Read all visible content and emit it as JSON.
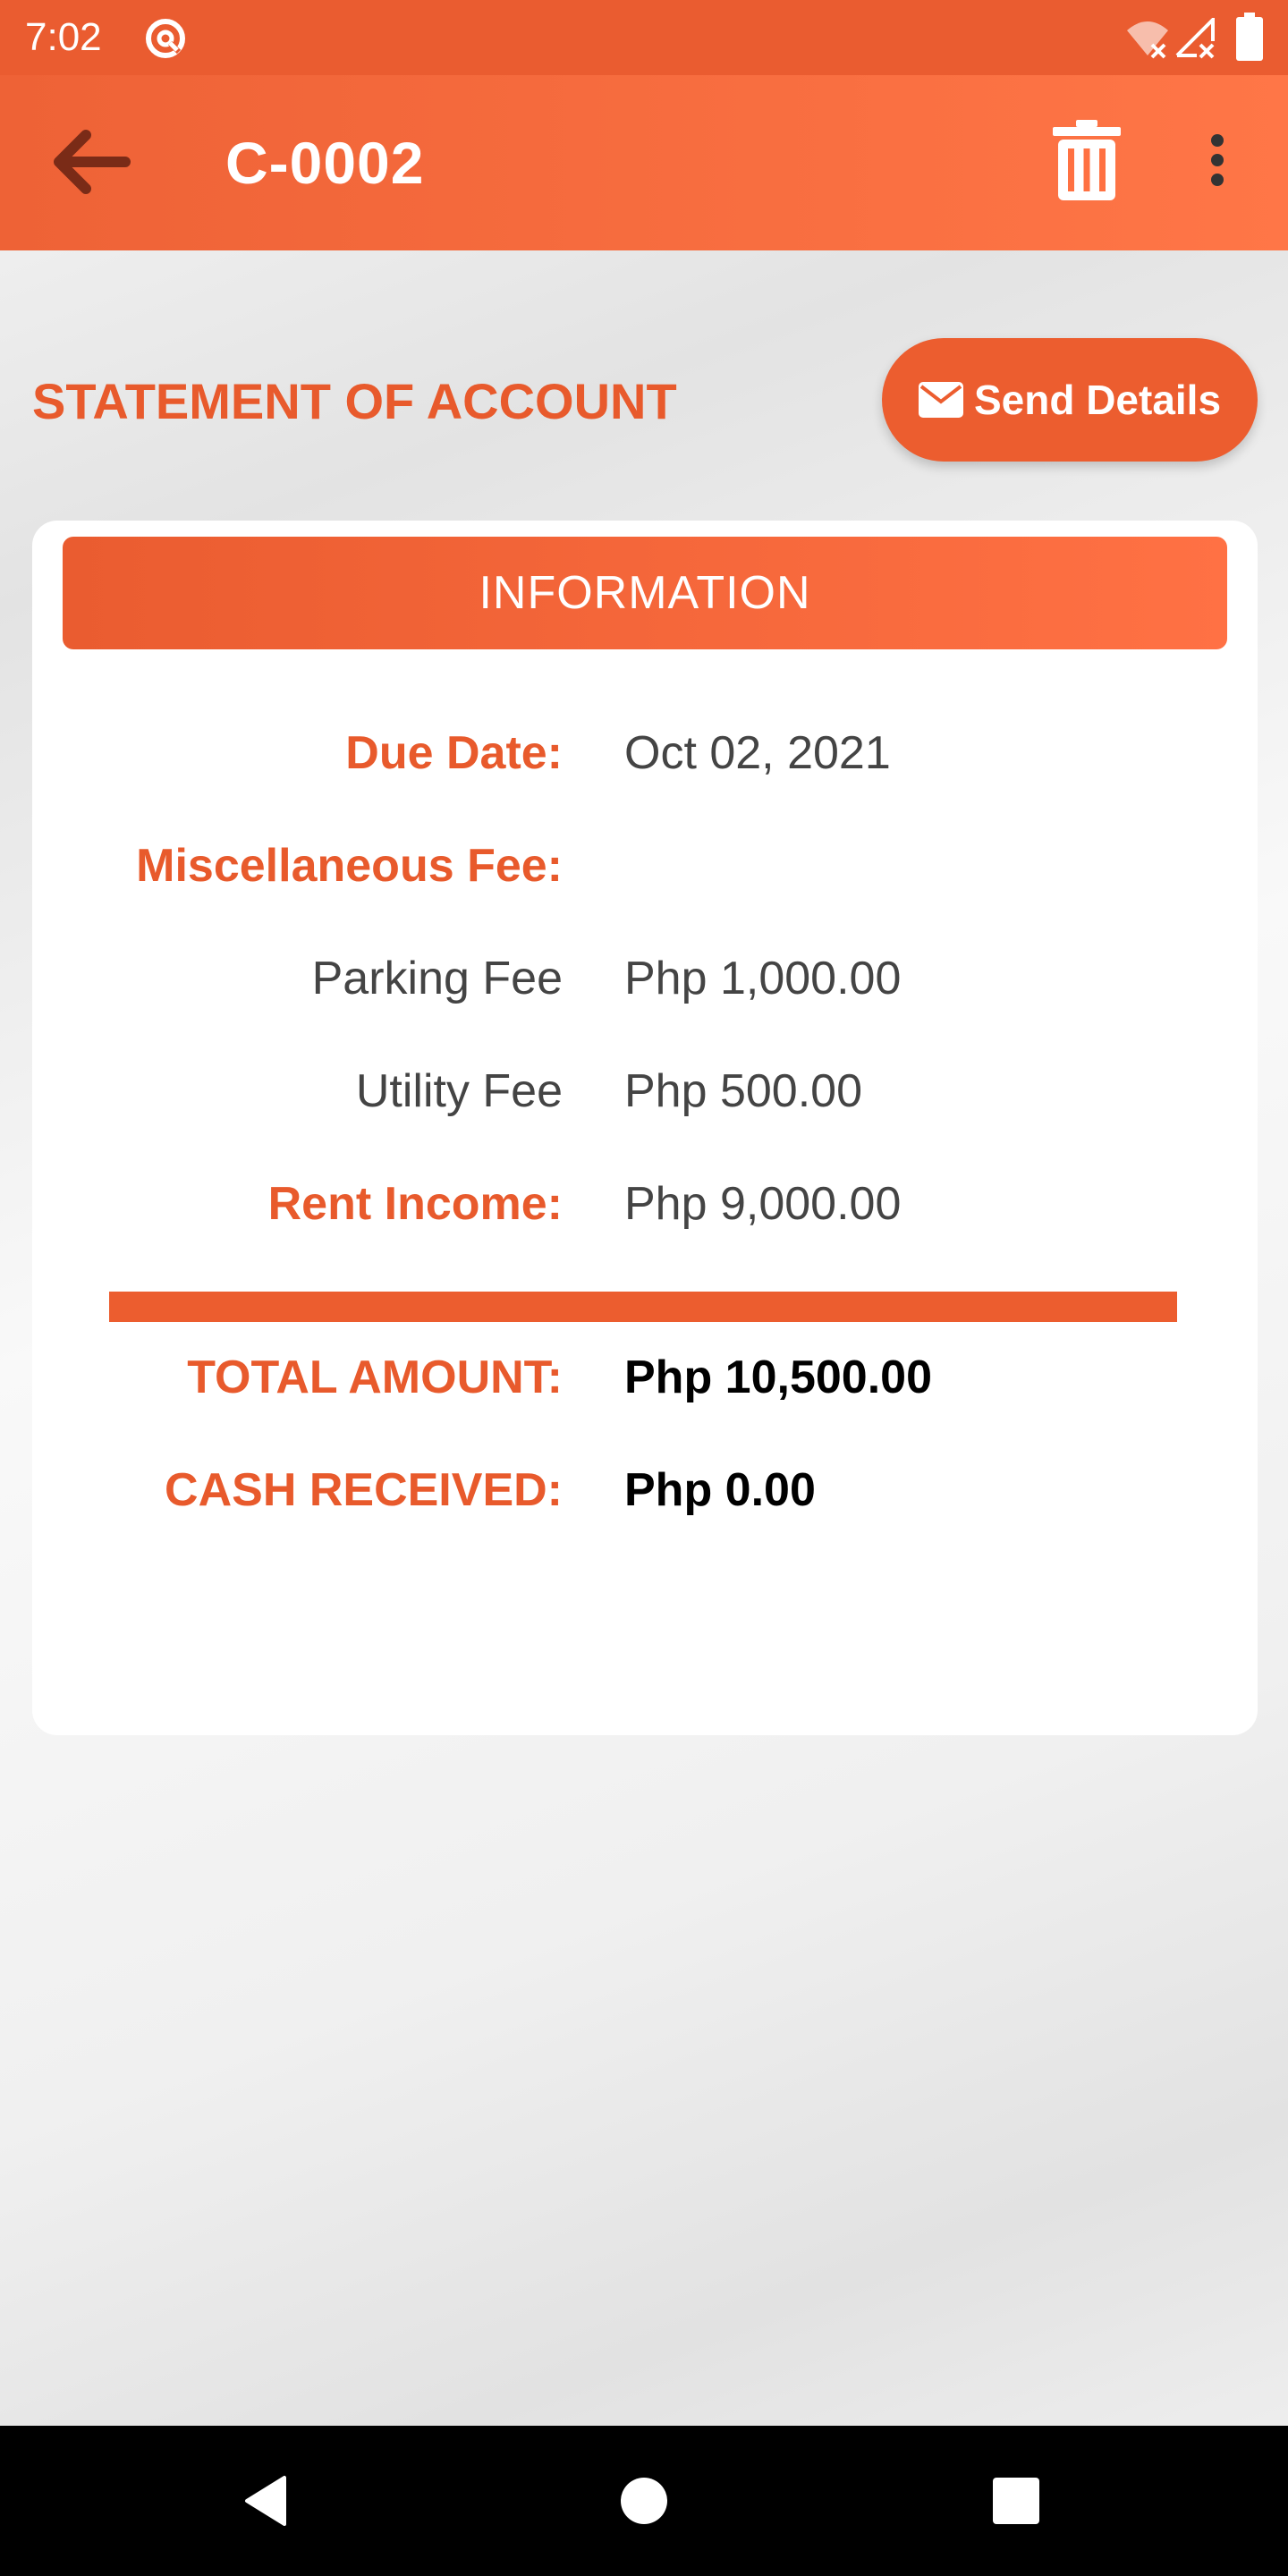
{
  "status_bar": {
    "time": "7:02"
  },
  "app_bar": {
    "title": "C-0002"
  },
  "statement": {
    "heading": "STATEMENT OF ACCOUNT",
    "send_button_label": "Send Details"
  },
  "card": {
    "header": "INFORMATION",
    "due_date": {
      "label": "Due Date:",
      "value": "Oct 02, 2021"
    },
    "misc_fee": {
      "label": "Miscellaneous Fee:"
    },
    "parking_fee": {
      "label": "Parking Fee",
      "value": "Php 1,000.00"
    },
    "utility_fee": {
      "label": "Utility Fee",
      "value": "Php 500.00"
    },
    "rent_income": {
      "label": "Rent Income:",
      "value": "Php 9,000.00"
    },
    "total_amount": {
      "label": "TOTAL AMOUNT:",
      "value": "Php 10,500.00"
    },
    "cash_received": {
      "label": "CASH RECEIVED:",
      "value": "Php 0.00"
    }
  },
  "icons": {
    "status_app": "at-sign-icon",
    "wifi": "wifi-off-icon",
    "signal": "signal-off-icon",
    "battery": "battery-icon",
    "back": "arrow-left-icon",
    "delete": "trash-icon",
    "more": "more-vert-icon",
    "send": "envelope-icon",
    "nav_back": "nav-back-icon",
    "nav_home": "nav-home-icon",
    "nav_recents": "nav-recents-icon"
  },
  "colors": {
    "primary": "#ea5c30",
    "primary_light": "#ff7647",
    "accent_text": "#e85a2c",
    "body_text": "#444444",
    "strong_text": "#000000"
  }
}
